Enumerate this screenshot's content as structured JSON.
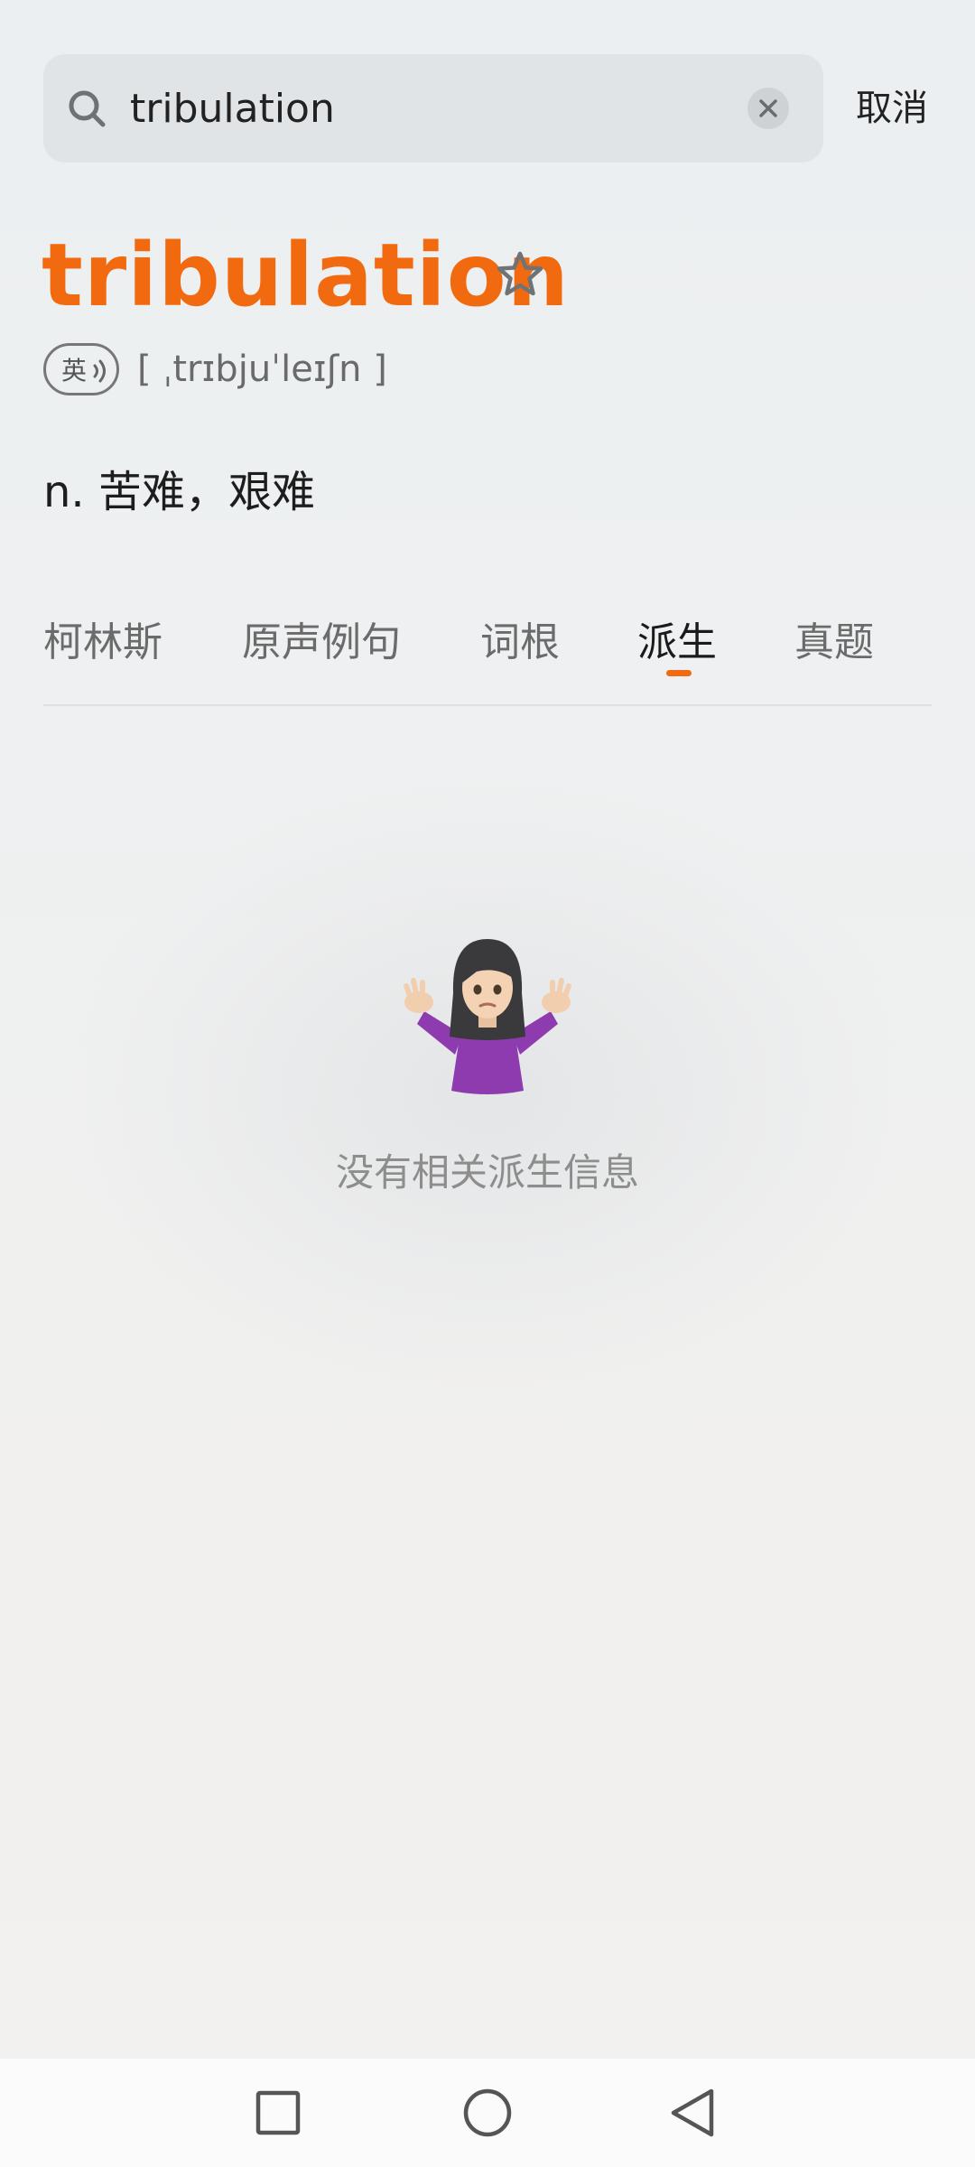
{
  "search": {
    "query": "tribulation",
    "cancel_label": "取消"
  },
  "word": {
    "headword": "tribulation",
    "pron_badge": "英",
    "phonetic": "[ ˌtrɪbjuˈleɪʃn ]",
    "definition": "n. 苦难，艰难"
  },
  "tabs": [
    {
      "label": "柯林斯",
      "active": false
    },
    {
      "label": "原声例句",
      "active": false
    },
    {
      "label": "词根",
      "active": false
    },
    {
      "label": "派生",
      "active": true
    },
    {
      "label": "真题",
      "active": false
    }
  ],
  "empty_state": {
    "message": "没有相关派生信息",
    "illustration": "person-shrugging-emoji"
  },
  "colors": {
    "accent": "#f26a10",
    "background": "#eef0f1"
  },
  "nav": {
    "icons": [
      "recent-apps-icon",
      "home-icon",
      "back-icon"
    ]
  }
}
